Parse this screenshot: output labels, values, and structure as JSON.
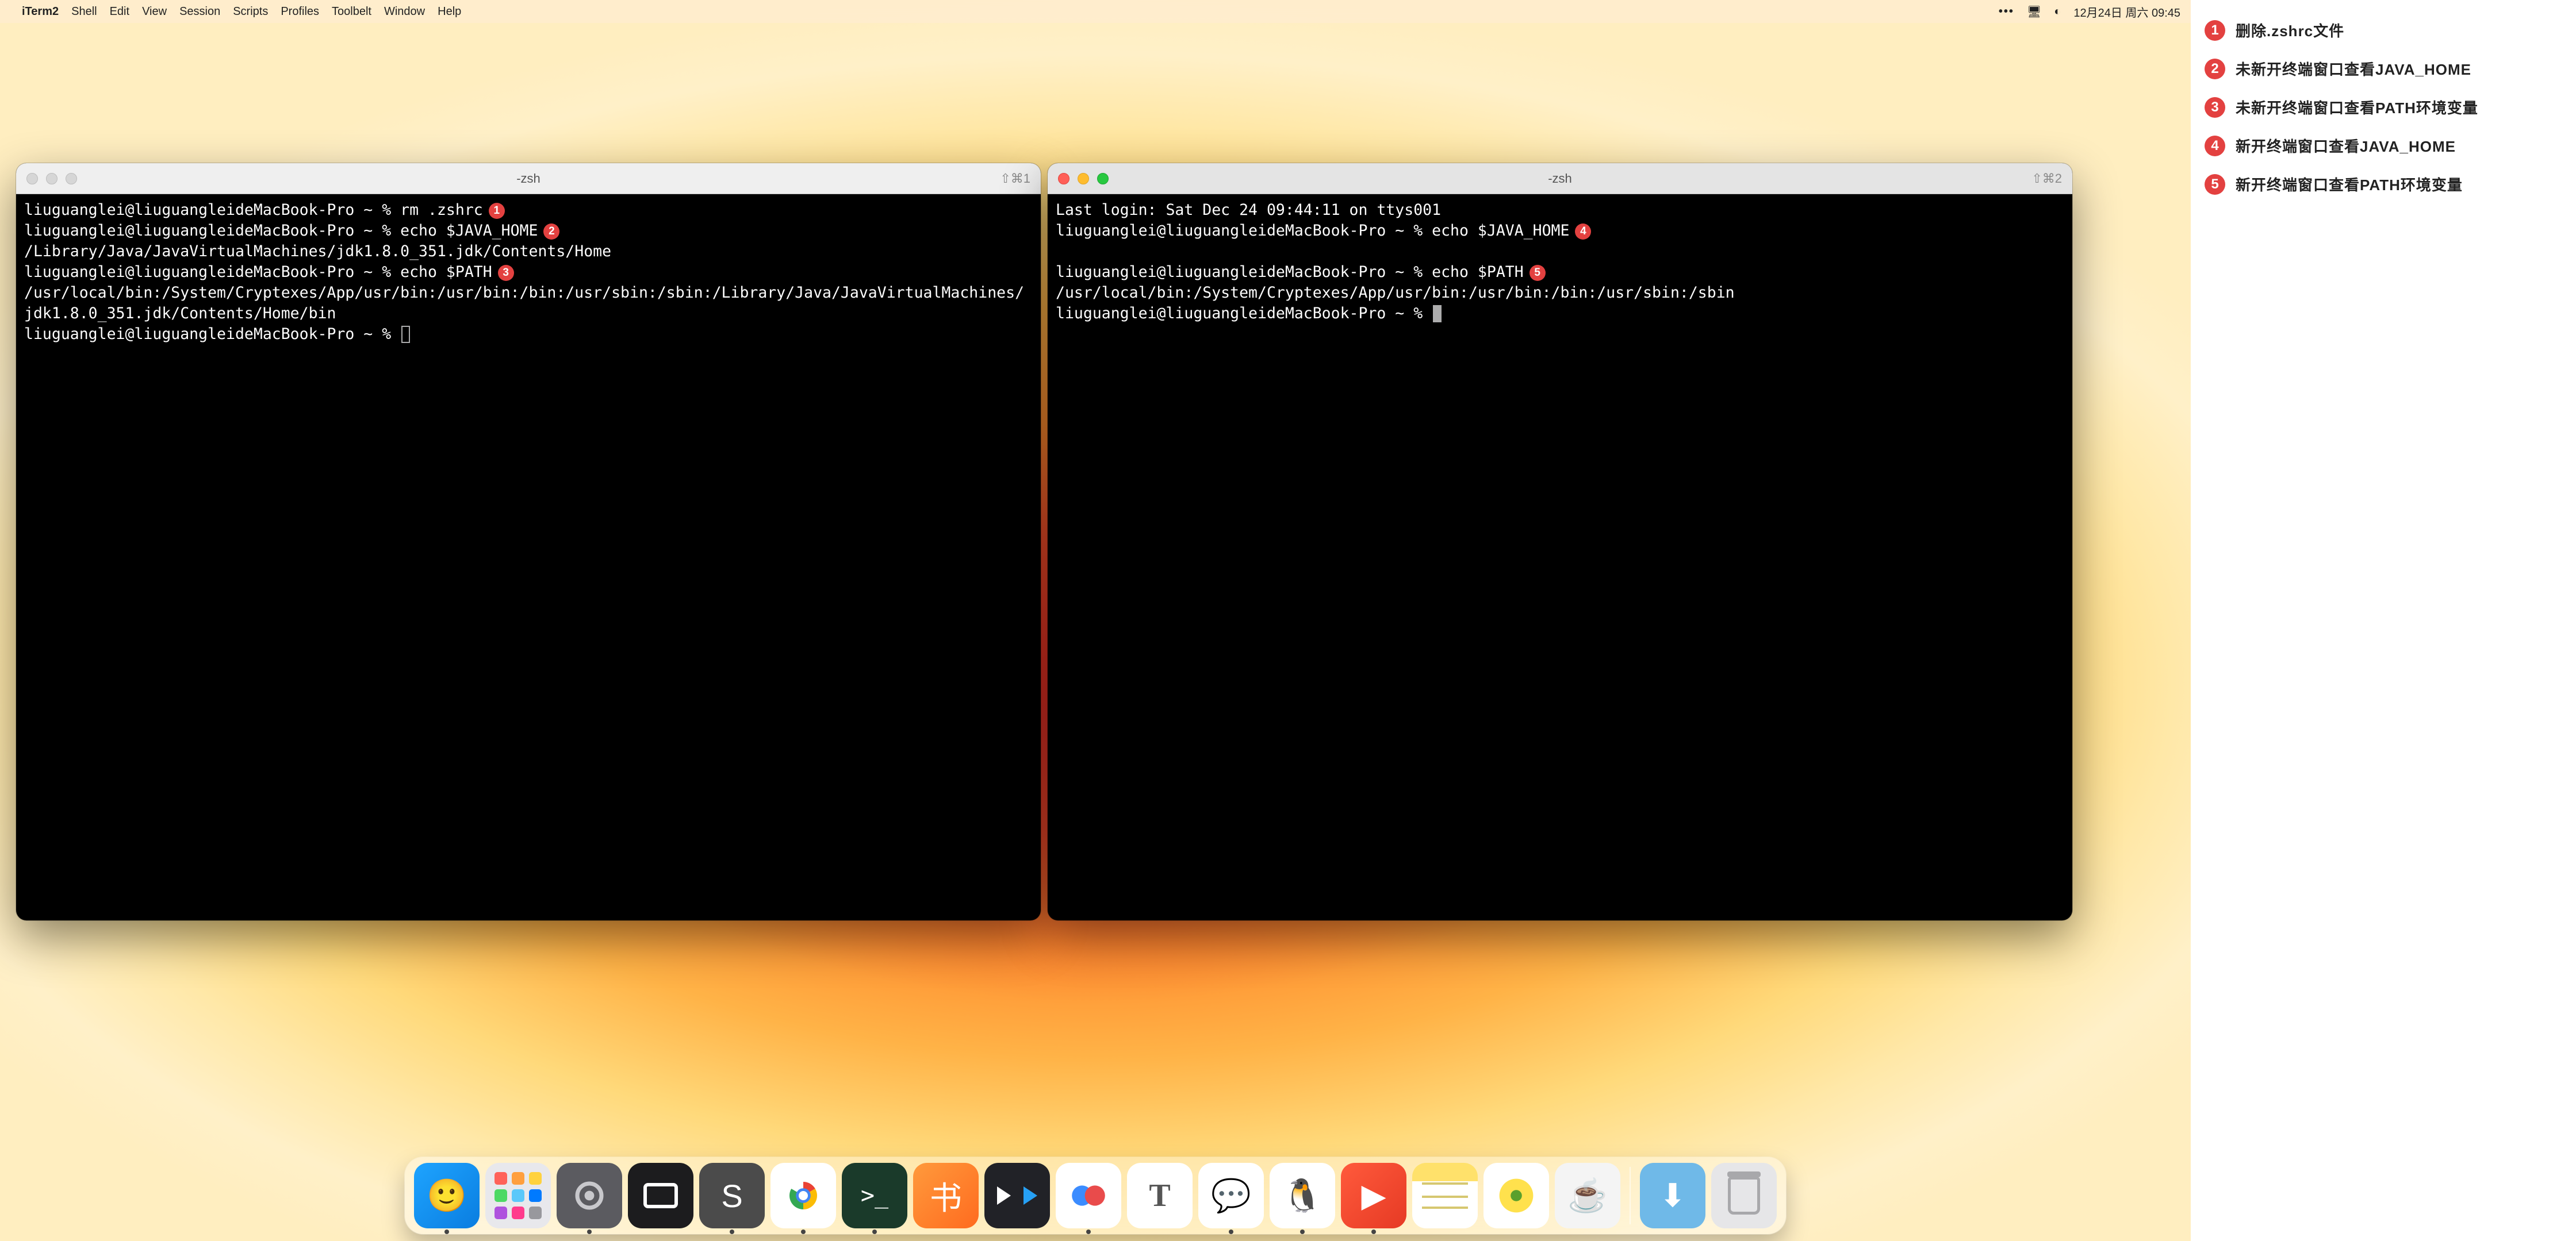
{
  "menubar": {
    "app_name": "iTerm2",
    "items": [
      "Shell",
      "Edit",
      "View",
      "Session",
      "Scripts",
      "Profiles",
      "Toolbelt",
      "Window",
      "Help"
    ],
    "clock": "12月24日 周六 09:45"
  },
  "terminals": {
    "left": {
      "title": "-zsh",
      "shortcut": "⇧⌘1",
      "lines": [
        {
          "prompt": "liuguanglei@liuguangleideMacBook-Pro ~ % ",
          "cmd": "rm .zshrc",
          "badge": "1"
        },
        {
          "prompt": "liuguanglei@liuguangleideMacBook-Pro ~ % ",
          "cmd": "echo $JAVA_HOME",
          "badge": "2"
        },
        {
          "out": "/Library/Java/JavaVirtualMachines/jdk1.8.0_351.jdk/Contents/Home"
        },
        {
          "prompt": "liuguanglei@liuguangleideMacBook-Pro ~ % ",
          "cmd": "echo $PATH",
          "badge": "3"
        },
        {
          "out": "/usr/local/bin:/System/Cryptexes/App/usr/bin:/usr/bin:/bin:/usr/sbin:/sbin:/Library/Java/JavaVirtualMachines/jdk1.8.0_351.jdk/Contents/Home/bin"
        },
        {
          "prompt": "liuguanglei@liuguangleideMacBook-Pro ~ % ",
          "cursor": "outline"
        }
      ]
    },
    "right": {
      "title": "-zsh",
      "shortcut": "⇧⌘2",
      "lines": [
        {
          "out": "Last login: Sat Dec 24 09:44:11 on ttys001"
        },
        {
          "prompt": "liuguanglei@liuguangleideMacBook-Pro ~ % ",
          "cmd": "echo $JAVA_HOME",
          "badge": "4"
        },
        {
          "out": " "
        },
        {
          "prompt": "liuguanglei@liuguangleideMacBook-Pro ~ % ",
          "cmd": "echo $PATH",
          "badge": "5"
        },
        {
          "out": "/usr/local/bin:/System/Cryptexes/App/usr/bin:/usr/bin:/bin:/usr/sbin:/sbin"
        },
        {
          "prompt": "liuguanglei@liuguangleideMacBook-Pro ~ % ",
          "cursor": "block"
        }
      ]
    }
  },
  "dock": {
    "items": [
      {
        "name": "finder",
        "dot": true,
        "glyph": "🙂"
      },
      {
        "name": "launchpad"
      },
      {
        "name": "settings",
        "dot": true
      },
      {
        "name": "screenshot"
      },
      {
        "name": "sublime",
        "dot": true,
        "glyph": "S"
      },
      {
        "name": "chrome",
        "dot": true
      },
      {
        "name": "iterm",
        "dot": true,
        "glyph": ">_"
      },
      {
        "name": "books",
        "glyph": "书"
      },
      {
        "name": "video"
      },
      {
        "name": "baidu",
        "dot": true,
        "glyph": "∞"
      },
      {
        "name": "textedit",
        "glyph": "T"
      },
      {
        "name": "wechat",
        "dot": true,
        "glyph": "💬"
      },
      {
        "name": "qq",
        "dot": true,
        "glyph": "🐧"
      },
      {
        "name": "wps",
        "dot": true,
        "glyph": "▶"
      },
      {
        "name": "notes"
      },
      {
        "name": "music",
        "glyph": "🎵"
      },
      {
        "name": "java",
        "glyph": "☕"
      }
    ],
    "right_items": [
      {
        "name": "downloads",
        "glyph": "⬇"
      },
      {
        "name": "trash"
      }
    ]
  },
  "annotations": [
    {
      "n": "1",
      "text": "删除.zshrc文件"
    },
    {
      "n": "2",
      "text": "未新开终端窗口查看JAVA_HOME"
    },
    {
      "n": "3",
      "text": "未新开终端窗口查看PATH环境变量"
    },
    {
      "n": "4",
      "text": "新开终端窗口查看JAVA_HOME"
    },
    {
      "n": "5",
      "text": "新开终端窗口查看PATH环境变量"
    }
  ]
}
